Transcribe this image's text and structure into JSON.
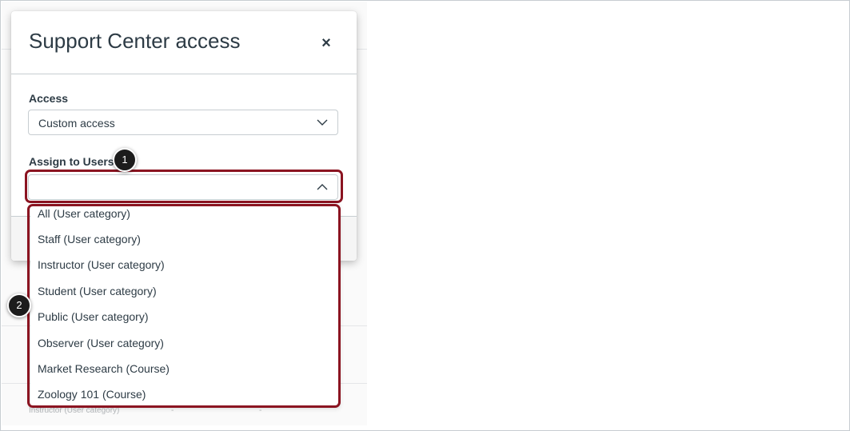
{
  "modal": {
    "title": "Support Center access",
    "close_symbol": "×",
    "access": {
      "label": "Access",
      "selected_value": "Custom access",
      "icon": "chevron-down-icon"
    },
    "assign": {
      "label": "Assign to Users",
      "value": "",
      "icon": "chevron-up-icon"
    }
  },
  "dropdown": {
    "options": [
      "All (User category)",
      "Staff (User category)",
      "Instructor (User category)",
      "Student (User category)",
      "Public (User category)",
      "Observer (User category)",
      "Market Research (Course)",
      "Zoology 101 (Course)"
    ]
  },
  "background": {
    "row_text": "Instructor (User category)",
    "dash": "-"
  },
  "callouts": {
    "one": "1",
    "two": "2"
  },
  "colors": {
    "highlight": "#8b1421",
    "text": "#2d3b45",
    "primary_button": "#2b7abc"
  }
}
